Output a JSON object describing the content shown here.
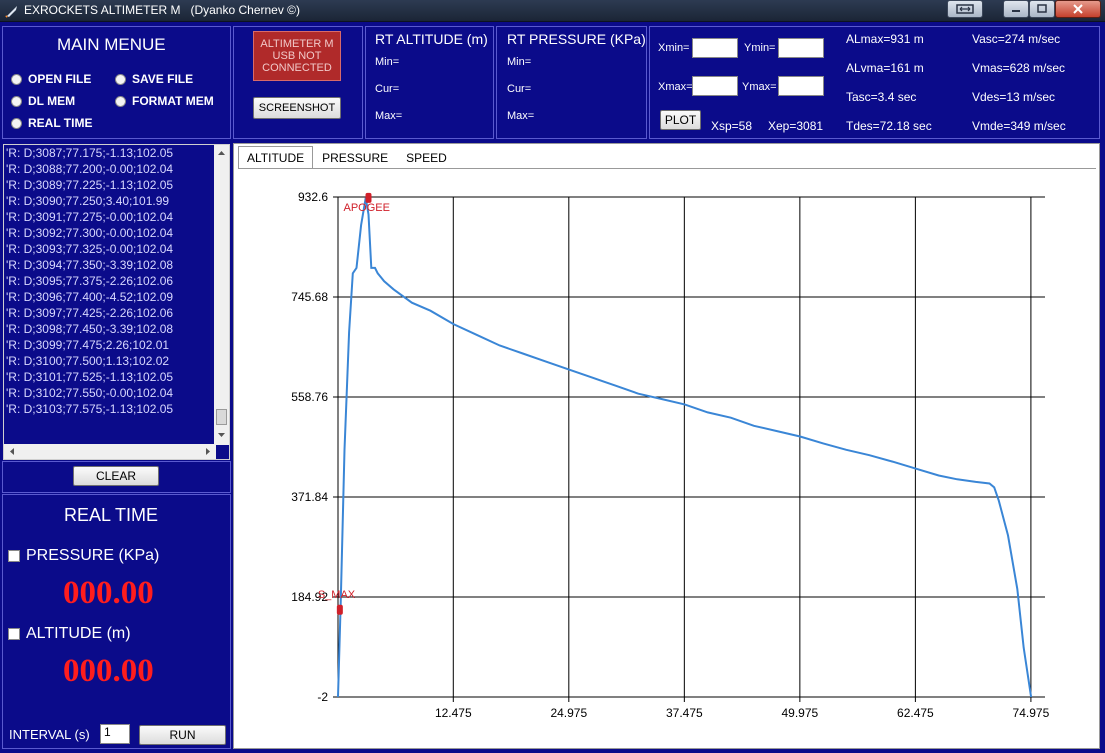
{
  "window": {
    "title": "EXROCKETS ALTIMETER M   (Dyanko Chernev ©)"
  },
  "main_menu": {
    "title": "MAIN MENUE",
    "items": [
      {
        "label": "OPEN FILE"
      },
      {
        "label": "SAVE FILE"
      },
      {
        "label": "DL MEM"
      },
      {
        "label": "FORMAT MEM"
      },
      {
        "label": "REAL TIME"
      }
    ]
  },
  "connection": {
    "status": "ALTIMETER M USB NOT CONNECTED",
    "status_color": "#b02a2a",
    "screenshot_label": "SCREENSHOT"
  },
  "rt_altitude": {
    "title": "RT ALTITUDE (m)",
    "min_label": "Min=",
    "cur_label": "Cur=",
    "max_label": "Max="
  },
  "rt_pressure": {
    "title": "RT PRESSURE (KPa)",
    "min_label": "Min=",
    "cur_label": "Cur=",
    "max_label": "Max="
  },
  "plot_controls": {
    "xmin_label": "Xmin=",
    "ymin_label": "Ymin=",
    "xmax_label": "Xmax=",
    "ymax_label": "Ymax=",
    "xmin_value": "",
    "ymin_value": "",
    "xmax_value": "",
    "ymax_value": "",
    "plot_label": "PLOT",
    "xsp": "Xsp=58",
    "xep": "Xep=3081"
  },
  "stats": {
    "almax": "ALmax=931 m",
    "alvma": "ALvma=161 m",
    "tasc": "Tasc=3.4 sec",
    "tdes": "Tdes=72.18 sec",
    "vasc": "Vasc=274 m/sec",
    "vmas": "Vmas=628 m/sec",
    "vdes": "Vdes=13 m/sec",
    "vmde": "Vmde=349 m/sec"
  },
  "log": {
    "lines": [
      "'R: D;3087;77.175;-1.13;102.05",
      "'R: D;3088;77.200;-0.00;102.04",
      "'R: D;3089;77.225;-1.13;102.05",
      "'R: D;3090;77.250;3.40;101.99",
      "'R: D;3091;77.275;-0.00;102.04",
      "'R: D;3092;77.300;-0.00;102.04",
      "'R: D;3093;77.325;-0.00;102.04",
      "'R: D;3094;77.350;-3.39;102.08",
      "'R: D;3095;77.375;-2.26;102.06",
      "'R: D;3096;77.400;-4.52;102.09",
      "'R: D;3097;77.425;-2.26;102.06",
      "'R: D;3098;77.450;-3.39;102.08",
      "'R: D;3099;77.475;2.26;102.01",
      "'R: D;3100;77.500;1.13;102.02",
      "'R: D;3101;77.525;-1.13;102.05",
      "'R: D;3102;77.550;-0.00;102.04",
      "'R: D;3103;77.575;-1.13;102.05"
    ],
    "clear_label": "CLEAR"
  },
  "real_time": {
    "title": "REAL TIME",
    "pressure_label": "PRESSURE (KPa)",
    "pressure_value": "000.00",
    "altitude_label": "ALTITUDE (m)",
    "altitude_value": "000.00",
    "interval_label": "INTERVAL (s)",
    "interval_value": "1",
    "run_label": "RUN",
    "value_color": "#ff1d1d"
  },
  "tabs": [
    {
      "label": "ALTITUDE",
      "active": true
    },
    {
      "label": "PRESSURE",
      "active": false
    },
    {
      "label": "SPEED",
      "active": false
    }
  ],
  "chart_data": {
    "type": "line",
    "ylim": [
      -2,
      932.6
    ],
    "xlim": [
      0,
      76.5
    ],
    "y_ticks": [
      "-2",
      "184.92",
      "371.84",
      "558.76",
      "745.68",
      "932.6"
    ],
    "x_ticks": [
      "12.475",
      "24.975",
      "37.475",
      "49.975",
      "62.475",
      "74.975"
    ],
    "annotations": [
      {
        "label": "APOGEE",
        "x": 3.3,
        "y": 931,
        "color": "#d0202a"
      },
      {
        "label": "S_MAX",
        "x": 0.2,
        "y": 161,
        "color": "#d0202a"
      }
    ],
    "series_color": "#3a86d6",
    "x": [
      0,
      0.3,
      0.7,
      1.2,
      1.6,
      2.0,
      2.5,
      3.0,
      3.3,
      3.6,
      4.0,
      4.3,
      5.0,
      6.0,
      8.0,
      10.0,
      12.5,
      15.0,
      17.5,
      20.0,
      22.5,
      25.0,
      27.5,
      30.0,
      32.5,
      35.0,
      37.5,
      40.0,
      42.5,
      45.0,
      47.5,
      50.0,
      52.5,
      55.0,
      57.5,
      60.0,
      62.5,
      65.0,
      67.0,
      69.0,
      70.5,
      71.0,
      71.5,
      72.5,
      73.5,
      74.2,
      75.0
    ],
    "y": [
      -2,
      180,
      460,
      680,
      790,
      800,
      880,
      931,
      900,
      800,
      800,
      790,
      775,
      760,
      735,
      720,
      695,
      675,
      655,
      640,
      625,
      610,
      595,
      580,
      565,
      555,
      545,
      530,
      520,
      505,
      495,
      485,
      472,
      460,
      450,
      438,
      425,
      412,
      405,
      400,
      397,
      390,
      365,
      300,
      200,
      90,
      -2
    ]
  }
}
